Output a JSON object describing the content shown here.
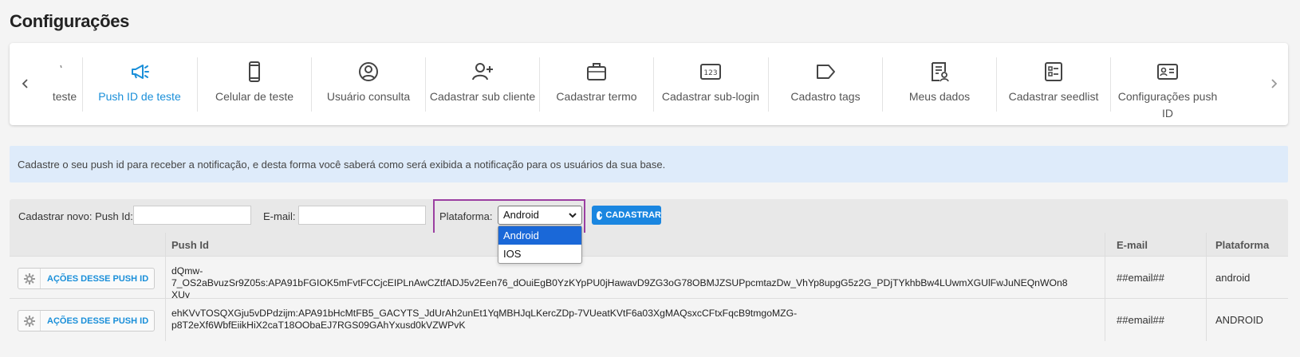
{
  "page": {
    "title": "Configurações"
  },
  "tabs": {
    "items": [
      {
        "label": "teste",
        "icon": "partial-tab-icon",
        "active": false
      },
      {
        "label": "Push ID de teste",
        "icon": "megaphone-icon",
        "active": true
      },
      {
        "label": "Celular de teste",
        "icon": "smartphone-icon",
        "active": false
      },
      {
        "label": "Usuário consulta",
        "icon": "user-circle-icon",
        "active": false
      },
      {
        "label": "Cadastrar sub cliente",
        "icon": "user-plus-icon",
        "active": false
      },
      {
        "label": "Cadastrar termo",
        "icon": "briefcase-icon",
        "active": false
      },
      {
        "label": "Cadastrar sub-login",
        "icon": "numeric-123-icon",
        "active": false
      },
      {
        "label": "Cadastro tags",
        "icon": "tag-icon",
        "active": false
      },
      {
        "label": "Meus dados",
        "icon": "profile-document-icon",
        "active": false
      },
      {
        "label": "Cadastrar seedlist",
        "icon": "checklist-icon",
        "active": false
      },
      {
        "label": "Configurações push ID",
        "icon": "id-card-icon",
        "active": false
      }
    ],
    "accent_color": "#1a8fd9"
  },
  "info": {
    "text": "Cadastre o seu push id para receber a notificação, e desta forma você saberá como será exibida a notificação para os usuários da sua base."
  },
  "form": {
    "pushid_label": "Cadastrar novo: Push Id:",
    "pushid_value": "",
    "email_label": "E-mail:",
    "email_value": "",
    "platform_label": "Plataforma:",
    "platform_selected": "Android",
    "platform_options": [
      "Android",
      "IOS"
    ],
    "submit_label": "CADASTRAR"
  },
  "table": {
    "headers": {
      "pushid": "Push Id",
      "email": "E-mail",
      "platform": "Plataforma"
    },
    "action_label": "AÇÕES DESSE PUSH ID",
    "rows": [
      {
        "pushid": "dQmw-7_OS2aBvuzSr9Z05s:APA91bFGIOK5mFvtFCCjcEIPLnAwCZtfADJ5v2Een76_dOuiEgB0YzKYpPU0jHawavD9ZG3oG78OBMJZSUPpcmtazDw_VhYp8upgG5z2G_PDjTYkhbBw4LUwmXGUlFwJuNEQnWOn8XUy",
        "pushid_line1": "dQmw-",
        "pushid_line2": "7_OS2aBvuzSr9Z05s:APA91bFGIOK5mFvtFCCjcEIPLnAwCZtfADJ5v2Een76_dOuiEgB0YzKYpPU0jHawavD9ZG3oG78OBMJZSUPpcmtazDw_VhYp8upgG5z2G_PDjTYkhbBw4LUwmXGUlFwJuNEQnWOn8XUy",
        "email": "##email##",
        "platform": "android"
      },
      {
        "pushid_line1": "ehKVvTOSQXGju5vDPdzijm:APA91bHcMtFB5_GACYTS_JdUrAh2unEt1YqMBHJqLKercZDp-7VUeatKVtF6a03XgMAQsxcCFtxFqcB9tmgoMZG-",
        "pushid_line2": "p8T2eXf6WbfEiikHiX2caT18OObaEJ7RGS09GAhYxusd0kVZWPvK",
        "email": "##email##",
        "platform": "ANDROID"
      }
    ]
  },
  "colors": {
    "highlight_border": "#9b3fa1",
    "button_blue": "#1a86e0",
    "banner_bg": "#deebfa",
    "dropdown_selected": "#1a68d8"
  }
}
